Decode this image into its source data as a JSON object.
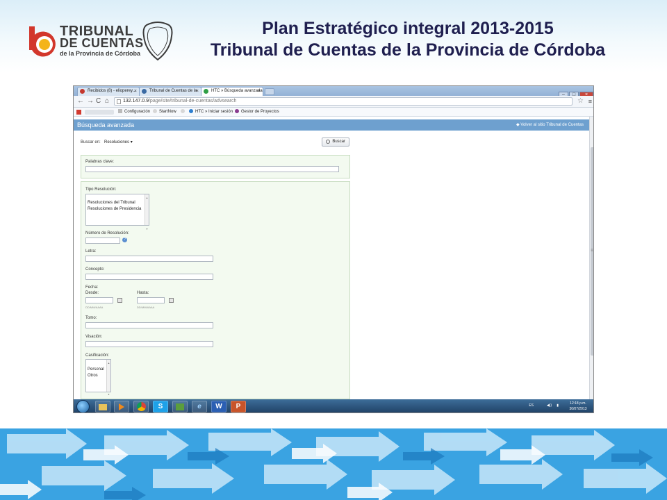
{
  "slide": {
    "title_line1": "Plan Estratégico integral 2013-2015",
    "title_line2": "Tribunal de Cuentas de la Provincia de Córdoba"
  },
  "logo": {
    "line1": "TRIBUNAL",
    "line2": "DE CUENTAS",
    "line3": "de la Provincia de Córdoba"
  },
  "browser": {
    "tabs": [
      {
        "label": "Recibidos (8) - elioperey...",
        "icon_color": "#c4372d"
      },
      {
        "label": "Tribunal de Cuentas de la",
        "icon_color": "#3b6aa3"
      },
      {
        "label": "HTC » Búsqueda avanzada",
        "icon_color": "#2e9e45"
      }
    ],
    "close_glyph": "×",
    "url_host": "132.147.0.9",
    "url_path": "/page/site/tribunal-de-cuentas/advsearch",
    "bookmarks": [
      {
        "label": "Configuración"
      },
      {
        "label": "StartNow"
      },
      {
        "label": "HTC » Iniciar sesión"
      },
      {
        "label": "Gestor de Proyectos"
      }
    ]
  },
  "page": {
    "heading": "Búsqueda avanzada",
    "back_link": "Volver al sitio Tribunal de Cuentas",
    "buscar_en_label": "Buscar en:",
    "buscar_en_value": "Resoluciones",
    "search_button": "Buscar",
    "palabras_clave_label": "Palabras clave:",
    "tipo_resolucion_label": "Tipo Resolución:",
    "tipo_resolucion_options": [
      "Resoluciones del Tribunal",
      "Resoluciones de Presidencia"
    ],
    "numero_label": "Número de Resolución:",
    "letra_label": "Letra:",
    "concepto_label": "Concepto:",
    "fecha_label": "Fecha:",
    "desde_label": "Desde:",
    "hasta_label": "Hasta:",
    "date_hint": "DD/MM/AAAA",
    "tomo_label": "Tomo:",
    "visacion_label": "Visación:",
    "casificacion_label": "Casificación:",
    "casificacion_options": [
      "Personal",
      "Otros"
    ]
  },
  "taskbar": {
    "apps": [
      "folder-icon",
      "media-player-icon",
      "chrome-icon",
      "skype-icon",
      "app-icon",
      "ie-icon",
      "word-icon",
      "powerpoint-icon"
    ],
    "skype_letter": "S",
    "ie_letter": "e",
    "word_letter": "W",
    "ppt_letter": "P",
    "language": "ES",
    "time": "12:18 p.m.",
    "date": "30/07/2013"
  },
  "colors": {
    "title": "#1f1f4f",
    "portlet_header": "#6ea0cf",
    "form_bg": "#f3faf0",
    "arrows_band": "#3aa3e2",
    "logo_red": "#d2372c",
    "logo_yellow": "#f4b41a"
  }
}
